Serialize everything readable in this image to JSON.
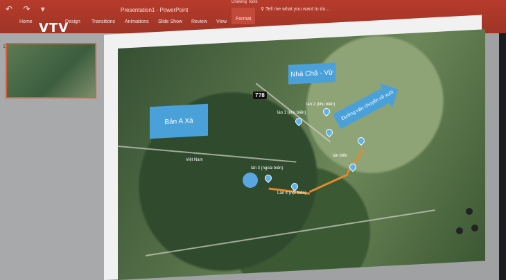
{
  "window": {
    "title": "Presentation1 - PowerPoint",
    "contextual_group": "Drawing Tools"
  },
  "ribbon": {
    "tabs": [
      "Home",
      "Design",
      "Transitions",
      "Animations",
      "Slide Show",
      "Review",
      "View",
      "Format"
    ],
    "active_tab": "Format",
    "tell_me": "Tell me what you want to do..."
  },
  "watermark": "VTV",
  "thumbnails": [
    {
      "number": "1"
    }
  ],
  "slide": {
    "box_left": "Bản A Xà",
    "box_top": "Nhà Chả - Vừ",
    "arrow": "Đường vận chuyển về xuôi",
    "badge": "7?8",
    "labels": {
      "lan2": "lán 2 (khu biến)",
      "lan1": "lán 1 (khu biến)",
      "lan3": "lán 3 (ngoài biến)",
      "lan4": "Lán 4 (nội biến)",
      "viet_nam": "Việt Nam",
      "lan_mien": "lán biến"
    }
  },
  "colors": {
    "ribbon": "#b73b2c",
    "accent_box": "#4aa0d9",
    "route": "#e38a2e"
  }
}
